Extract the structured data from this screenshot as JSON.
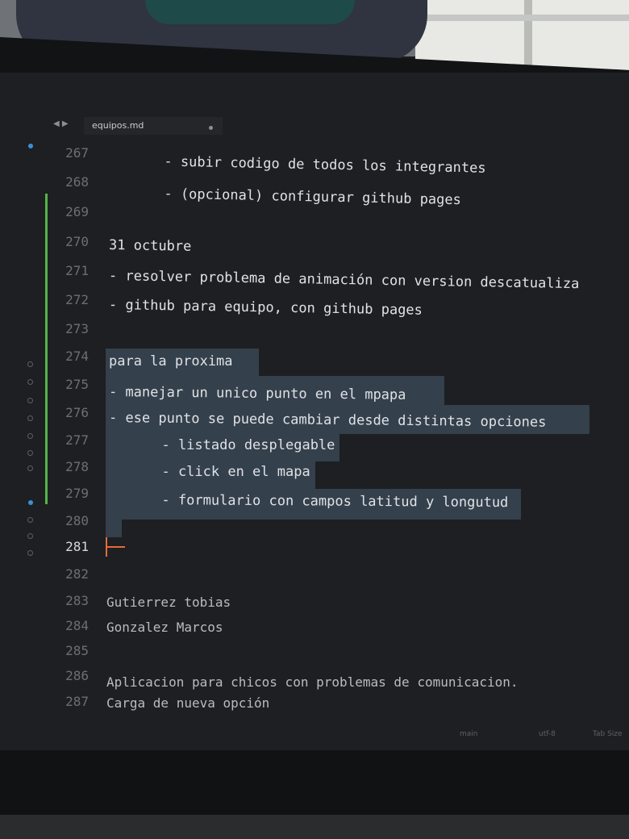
{
  "editor": {
    "tab": {
      "filename": "equipos.md"
    },
    "lines": [
      {
        "num": "267",
        "text": "  - subir codigo de todos los integrantes"
      },
      {
        "num": "268",
        "text": "  - (opcional) configurar github pages"
      },
      {
        "num": "269",
        "text": ""
      },
      {
        "num": "270",
        "text": "31 octubre"
      },
      {
        "num": "271",
        "text": "- resolver problema de animación con version descatualiza"
      },
      {
        "num": "272",
        "text": "- github para equipo, con github pages"
      },
      {
        "num": "273",
        "text": ""
      },
      {
        "num": "274",
        "text": "para la proxima"
      },
      {
        "num": "275",
        "text": "- manejar un unico punto en el mpapa"
      },
      {
        "num": "276",
        "text": "- ese punto se puede cambiar desde distintas opciones"
      },
      {
        "num": "277",
        "text": "  - listado desplegable"
      },
      {
        "num": "278",
        "text": "  - click en el mapa"
      },
      {
        "num": "279",
        "text": "  - formulario con campos latitud y longutud"
      },
      {
        "num": "280",
        "text": ""
      },
      {
        "num": "281",
        "text": ""
      },
      {
        "num": "282",
        "text": ""
      },
      {
        "num": "283",
        "text": "Gutierrez tobias"
      },
      {
        "num": "284",
        "text": "Gonzalez Marcos"
      },
      {
        "num": "285",
        "text": ""
      },
      {
        "num": "286",
        "text": "Aplicacion para chicos con problemas de comunicacion."
      },
      {
        "num": "287",
        "text": "Carga de nueva opción"
      }
    ],
    "current_line": "281"
  },
  "statusbar": {
    "branch": "main",
    "encoding": "utf-8",
    "indent": "Tab Size"
  },
  "colors": {
    "background": "#1e1f22",
    "text": "#dfe2e6",
    "line_number": "#6b6f75",
    "selection": "#34404c",
    "cursor": "#e46b3a",
    "git_added": "#56b34a"
  }
}
